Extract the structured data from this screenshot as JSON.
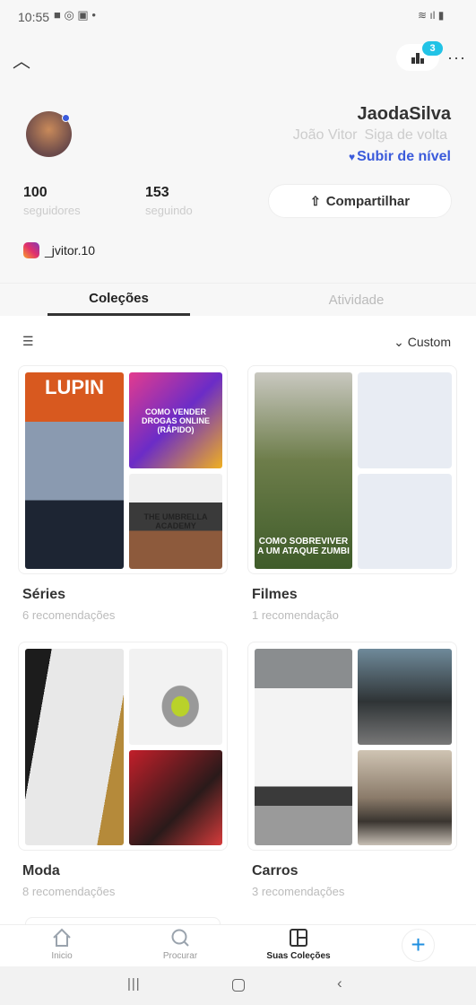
{
  "status": {
    "time": "10:55"
  },
  "header": {
    "badge_count": "3"
  },
  "profile": {
    "username": "JaodaSilva",
    "name": "João Vitor",
    "follow_back": "Siga de volta",
    "level_up": "Subir de nível",
    "followers": "100",
    "followers_label": "seguidores",
    "following": "153",
    "following_label": "seguindo",
    "share_label": "Compartilhar",
    "instagram": "_jvitor.10"
  },
  "tabs": [
    {
      "label": "Coleções",
      "active": true
    },
    {
      "label": "Atividade",
      "active": false
    }
  ],
  "sort": {
    "label": "Custom"
  },
  "collections": [
    {
      "title": "Séries",
      "subtitle": "6 recomendações",
      "posters": [
        "LUPIN",
        "COMO VENDER DROGAS ONLINE (RÁPIDO)",
        "THE UMBRELLA ACADEMY"
      ]
    },
    {
      "title": "Filmes",
      "subtitle": "1 recomendação",
      "posters": [
        "COMO SOBREVIVER A UM ATAQUE ZUMBI"
      ]
    },
    {
      "title": "Moda",
      "subtitle": "8 recomendações"
    },
    {
      "title": "Carros",
      "subtitle": "3 recomendações"
    }
  ],
  "bottom_nav": [
    {
      "label": "Inicio",
      "icon": "home-icon"
    },
    {
      "label": "Procurar",
      "icon": "search-icon"
    },
    {
      "label": "Suas Coleções",
      "icon": "collections-icon",
      "active": true
    }
  ],
  "colors": {
    "accent": "#3b5bdb",
    "badge": "#22c3e6",
    "plus": "#1f8fe0"
  }
}
